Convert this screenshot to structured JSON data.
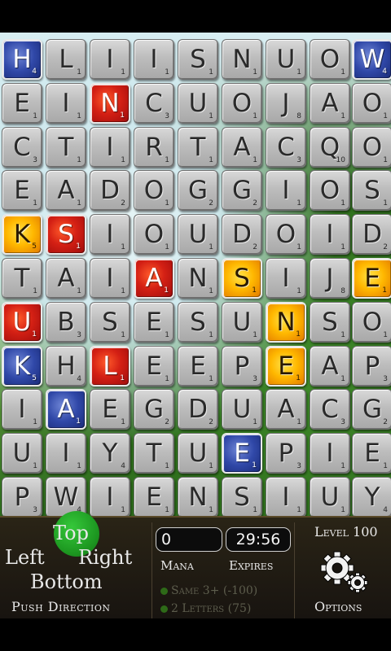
{
  "board": {
    "rows": [
      [
        {
          "l": "H",
          "v": "4",
          "t": "blue"
        },
        {
          "l": "L",
          "v": "1"
        },
        {
          "l": "I",
          "v": "1"
        },
        {
          "l": "I",
          "v": "1"
        },
        {
          "l": "S",
          "v": "1"
        },
        {
          "l": "N",
          "v": "1"
        },
        {
          "l": "U",
          "v": "1"
        },
        {
          "l": "O",
          "v": "1"
        },
        {
          "l": "W",
          "v": "4",
          "t": "blue"
        }
      ],
      [
        {
          "l": "E",
          "v": "1"
        },
        {
          "l": "I",
          "v": "1"
        },
        {
          "l": "N",
          "v": "1",
          "t": "red"
        },
        {
          "l": "C",
          "v": "3"
        },
        {
          "l": "U",
          "v": "1"
        },
        {
          "l": "O",
          "v": "1"
        },
        {
          "l": "J",
          "v": "8"
        },
        {
          "l": "A",
          "v": "1"
        },
        {
          "l": "O",
          "v": "1"
        }
      ],
      [
        {
          "l": "C",
          "v": "3"
        },
        {
          "l": "T",
          "v": "1"
        },
        {
          "l": "I",
          "v": "1"
        },
        {
          "l": "R",
          "v": "1"
        },
        {
          "l": "T",
          "v": "1"
        },
        {
          "l": "A",
          "v": "1"
        },
        {
          "l": "C",
          "v": "3"
        },
        {
          "l": "Q",
          "v": "10"
        },
        {
          "l": "O",
          "v": "1"
        }
      ],
      [
        {
          "l": "E",
          "v": "1"
        },
        {
          "l": "A",
          "v": "1"
        },
        {
          "l": "D",
          "v": "2"
        },
        {
          "l": "O",
          "v": "1"
        },
        {
          "l": "G",
          "v": "2"
        },
        {
          "l": "G",
          "v": "2"
        },
        {
          "l": "I",
          "v": "1"
        },
        {
          "l": "O",
          "v": "1"
        },
        {
          "l": "S",
          "v": "1"
        }
      ],
      [
        {
          "l": "K",
          "v": "5",
          "t": "orange"
        },
        {
          "l": "S",
          "v": "1",
          "t": "red"
        },
        {
          "l": "I",
          "v": "1"
        },
        {
          "l": "O",
          "v": "1"
        },
        {
          "l": "U",
          "v": "1"
        },
        {
          "l": "D",
          "v": "2"
        },
        {
          "l": "O",
          "v": "1"
        },
        {
          "l": "I",
          "v": "1"
        },
        {
          "l": "D",
          "v": "2"
        }
      ],
      [
        {
          "l": "T",
          "v": "1"
        },
        {
          "l": "A",
          "v": "1"
        },
        {
          "l": "I",
          "v": "1"
        },
        {
          "l": "A",
          "v": "1",
          "t": "red"
        },
        {
          "l": "N",
          "v": "1"
        },
        {
          "l": "S",
          "v": "1",
          "t": "orange"
        },
        {
          "l": "I",
          "v": "1"
        },
        {
          "l": "J",
          "v": "8"
        },
        {
          "l": "E",
          "v": "1",
          "t": "orange"
        }
      ],
      [
        {
          "l": "U",
          "v": "1",
          "t": "red"
        },
        {
          "l": "B",
          "v": "3"
        },
        {
          "l": "S",
          "v": "1"
        },
        {
          "l": "E",
          "v": "1"
        },
        {
          "l": "S",
          "v": "1"
        },
        {
          "l": "U",
          "v": "1"
        },
        {
          "l": "N",
          "v": "1",
          "t": "orange"
        },
        {
          "l": "S",
          "v": "1"
        },
        {
          "l": "O",
          "v": "1"
        }
      ],
      [
        {
          "l": "K",
          "v": "5",
          "t": "blue"
        },
        {
          "l": "H",
          "v": "4"
        },
        {
          "l": "L",
          "v": "1",
          "t": "red"
        },
        {
          "l": "E",
          "v": "1"
        },
        {
          "l": "E",
          "v": "1"
        },
        {
          "l": "P",
          "v": "3"
        },
        {
          "l": "E",
          "v": "1",
          "t": "orange"
        },
        {
          "l": "A",
          "v": "1"
        },
        {
          "l": "P",
          "v": "3"
        }
      ],
      [
        {
          "l": "I",
          "v": "1"
        },
        {
          "l": "A",
          "v": "1",
          "t": "blue"
        },
        {
          "l": "E",
          "v": "1"
        },
        {
          "l": "G",
          "v": "2"
        },
        {
          "l": "D",
          "v": "2"
        },
        {
          "l": "U",
          "v": "1"
        },
        {
          "l": "A",
          "v": "1"
        },
        {
          "l": "C",
          "v": "3"
        },
        {
          "l": "G",
          "v": "2"
        }
      ],
      [
        {
          "l": "U",
          "v": "1"
        },
        {
          "l": "I",
          "v": "1"
        },
        {
          "l": "Y",
          "v": "4"
        },
        {
          "l": "T",
          "v": "1"
        },
        {
          "l": "U",
          "v": "1"
        },
        {
          "l": "E",
          "v": "1",
          "t": "blue"
        },
        {
          "l": "P",
          "v": "3"
        },
        {
          "l": "I",
          "v": "1"
        },
        {
          "l": "E",
          "v": "1"
        }
      ],
      [
        {
          "l": "P",
          "v": "3"
        },
        {
          "l": "W",
          "v": "4"
        },
        {
          "l": "I",
          "v": "1"
        },
        {
          "l": "E",
          "v": "1"
        },
        {
          "l": "N",
          "v": "1"
        },
        {
          "l": "S",
          "v": "1"
        },
        {
          "l": "I",
          "v": "1"
        },
        {
          "l": "U",
          "v": "1"
        },
        {
          "l": "Y",
          "v": "4"
        }
      ]
    ]
  },
  "controls": {
    "top": "Top",
    "left": "Left",
    "right": "Right",
    "bottom": "Bottom",
    "push_direction": "Push Direction"
  },
  "stats": {
    "mana_value": "0",
    "timer": "29:56",
    "mana_label": "Mana",
    "expires_label": "Expires",
    "bonus_1": "Same 3+ (-100)",
    "bonus_2": "2 Letters (75)"
  },
  "level_label": "Level 100",
  "options_label": "Options",
  "icons": {
    "options": "gear-icon"
  },
  "colors": {
    "red_tile": "#d42014",
    "blue_tile": "#3048a8",
    "orange_tile": "#ffb800",
    "green_accent": "#1e9a22"
  }
}
